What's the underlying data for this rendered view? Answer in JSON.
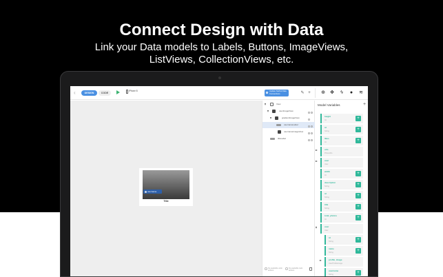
{
  "headline": "Connect Design with Data",
  "subline_1": "Link your Data models to Labels, Buttons, ImageViews,",
  "subline_2": "ListViews, CollectionViews, etc.",
  "colors": {
    "accent_blue": "#4a90e2",
    "accent_green": "#2fb89a",
    "play_green": "#3cb371",
    "background_dark": "#000000"
  },
  "toolbar": {
    "design_label": "DESIGN",
    "code_label": "CODE",
    "device_label": "iPhone 8",
    "update_button": "Update Swiftui Data Connections",
    "tool_icons": [
      "pen-icon",
      "plus-icon",
      "target-icon",
      "move-icon",
      "bolt-icon",
      "palette-icon",
      "stack-icon"
    ]
  },
  "canvas": {
    "cell_badge": "username",
    "cell_title": "Title"
  },
  "hierarchy": {
    "rows": [
      {
        "label": "View"
      },
      {
        "label": "userImageView"
      },
      {
        "label": "gradientImageView"
      },
      {
        "label": "usernameLabel"
      },
      {
        "label": "usernameImageView"
      },
      {
        "label": "titleLabel"
      }
    ],
    "footer_left": "No available undo actions",
    "footer_right": "No available redo actions"
  },
  "model_variables": {
    "header": "Model Variables",
    "items": [
      {
        "name": "height",
        "type": "Int"
      },
      {
        "name": "id",
        "type": "String"
      },
      {
        "name": "likes",
        "type": "Int"
      },
      {
        "name": "urls",
        "type": "PhotoUrls"
      },
      {
        "name": "user",
        "type": "User"
      },
      {
        "name": "width",
        "type": "Int"
      },
      {
        "name": "description",
        "type": "String"
      },
      {
        "name": "id",
        "type": "String"
      },
      {
        "name": "title",
        "type": "String"
      },
      {
        "name": "total_photos",
        "type": "Int"
      },
      {
        "name": "user",
        "type": "User"
      },
      {
        "name": "id",
        "type": "String"
      },
      {
        "name": "name",
        "type": "String"
      },
      {
        "name": "profile_image",
        "type": "UserProfileImage"
      },
      {
        "name": "username",
        "type": "String"
      }
    ]
  }
}
